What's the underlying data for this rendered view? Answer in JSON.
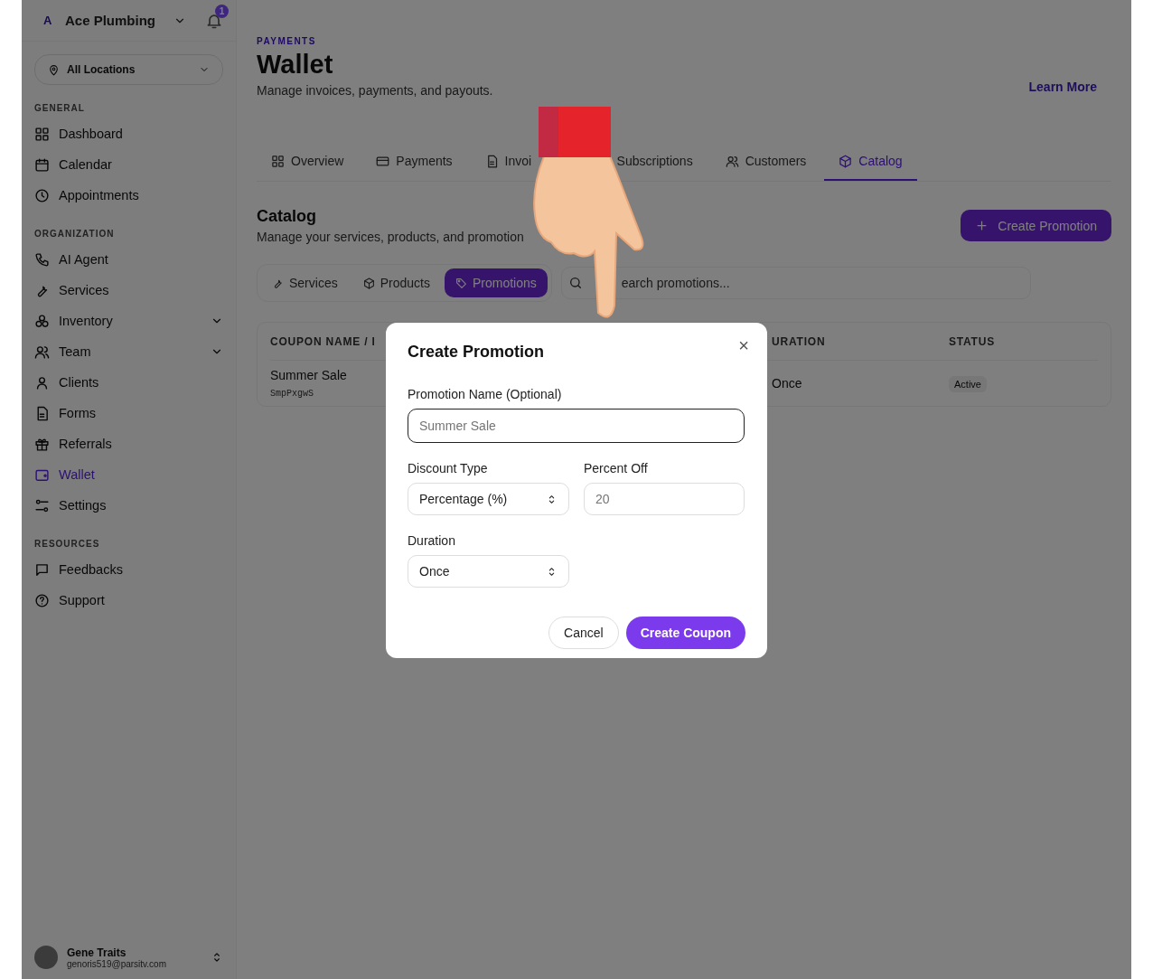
{
  "sidebar": {
    "business": {
      "initial": "A",
      "name": "Ace Plumbing"
    },
    "notification_count": "1",
    "location": "All Locations",
    "sections": [
      {
        "title": "GENERAL",
        "items": [
          {
            "label": "Dashboard",
            "selected": false,
            "expandable": false
          },
          {
            "label": "Calendar",
            "selected": false,
            "expandable": false
          },
          {
            "label": "Appointments",
            "selected": false,
            "expandable": false
          }
        ]
      },
      {
        "title": "ORGANIZATION",
        "items": [
          {
            "label": "AI Agent",
            "selected": false,
            "expandable": false
          },
          {
            "label": "Services",
            "selected": false,
            "expandable": false
          },
          {
            "label": "Inventory",
            "selected": false,
            "expandable": true
          },
          {
            "label": "Team",
            "selected": false,
            "expandable": true
          },
          {
            "label": "Clients",
            "selected": false,
            "expandable": false
          },
          {
            "label": "Forms",
            "selected": false,
            "expandable": false
          },
          {
            "label": "Referrals",
            "selected": false,
            "expandable": false
          },
          {
            "label": "Wallet",
            "selected": true,
            "expandable": false
          },
          {
            "label": "Settings",
            "selected": false,
            "expandable": false
          }
        ]
      },
      {
        "title": "RESOURCES",
        "items": [
          {
            "label": "Feedbacks",
            "selected": false,
            "expandable": false
          },
          {
            "label": "Support",
            "selected": false,
            "expandable": false
          }
        ]
      }
    ],
    "user": {
      "name": "Gene Traits",
      "email": "genoris519@parsitv.com"
    }
  },
  "header": {
    "eyebrow": "PAYMENTS",
    "title": "Wallet",
    "subtitle": "Manage invoices, payments, and payouts.",
    "link": "Learn More"
  },
  "tabs": [
    {
      "label": "Overview",
      "selected": false
    },
    {
      "label": "Payments",
      "selected": false
    },
    {
      "label": "Invoi",
      "selected": false
    },
    {
      "label": "Subscriptions",
      "selected": false
    },
    {
      "label": "Customers",
      "selected": false
    },
    {
      "label": "Catalog",
      "selected": true
    }
  ],
  "catalog": {
    "title": "Catalog",
    "subtitle": "Manage your services, products, and promotion",
    "create_button": "Create Promotion",
    "subtabs": [
      {
        "label": "Services",
        "selected": false
      },
      {
        "label": "Products",
        "selected": false
      },
      {
        "label": "Promotions",
        "selected": true
      }
    ],
    "search": {
      "placeholder": "earch promotions..."
    },
    "table": {
      "columns": [
        "COUPON NAME / I",
        "URATION",
        "STATUS"
      ],
      "rows": [
        {
          "name": "Summer Sale",
          "code": "SmpPxgwS",
          "duration": "Once",
          "status": "Active"
        }
      ]
    }
  },
  "modal": {
    "title": "Create Promotion",
    "close": "×",
    "fields": [
      {
        "kind": "text",
        "label": "Promotion Name (Optional)",
        "placeholder": "Summer Sale",
        "focused": true
      },
      {
        "kind": "select",
        "label": "Discount Type",
        "value": "Percentage (%)"
      },
      {
        "kind": "text",
        "label": "Percent Off",
        "placeholder": "20",
        "focused": false
      },
      {
        "kind": "select",
        "label": "Duration",
        "value": "Once"
      }
    ],
    "buttons": [
      {
        "label": "Cancel",
        "kind": "secondary"
      },
      {
        "label": "Create Coupon",
        "kind": "primary"
      }
    ]
  }
}
